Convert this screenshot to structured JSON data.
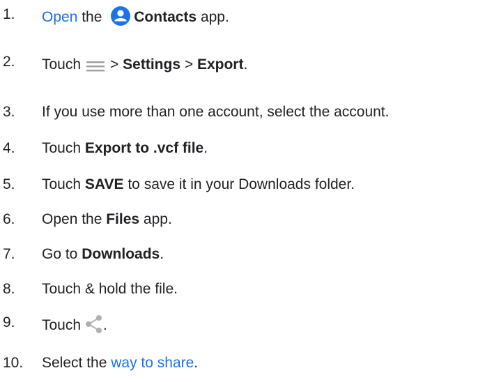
{
  "steps": [
    {
      "number": "1.",
      "t1": "Open",
      "t2": " the ",
      "icon": "contacts-app-icon",
      "t3": "Contacts",
      "t4": " app."
    },
    {
      "number": "2.",
      "t1": "Touch",
      "icon": "menu-icon",
      "t2": "> ",
      "t3": "Settings",
      "t4": " > ",
      "t5": "Export",
      "t6": "."
    },
    {
      "number": "3.",
      "t1": "If you use more than one account, select the account."
    },
    {
      "number": "4.",
      "t1": "Touch ",
      "t2": "Export to .vcf file",
      "t3": "."
    },
    {
      "number": "5.",
      "t1": "Touch ",
      "t2": "SAVE",
      "t3": " to save it in your Downloads folder."
    },
    {
      "number": "6.",
      "t1": "Open the ",
      "t2": "Files",
      "t3": " app."
    },
    {
      "number": "7.",
      "t1": "Go to ",
      "t2": "Downloads",
      "t3": "."
    },
    {
      "number": "8.",
      "t1": "Touch & hold the file."
    },
    {
      "number": "9.",
      "t1": "Touch",
      "icon": "share-icon",
      "t2": "."
    },
    {
      "number": "10.",
      "t1": "Select the ",
      "t2": "way to share",
      "t3": "."
    }
  ],
  "colors": {
    "text": "#202124",
    "link": "#1a73e8",
    "contacts_icon": "#1a73e8",
    "menu_icon": "#9e9e9e",
    "share_icon": "#b0b0b0"
  }
}
